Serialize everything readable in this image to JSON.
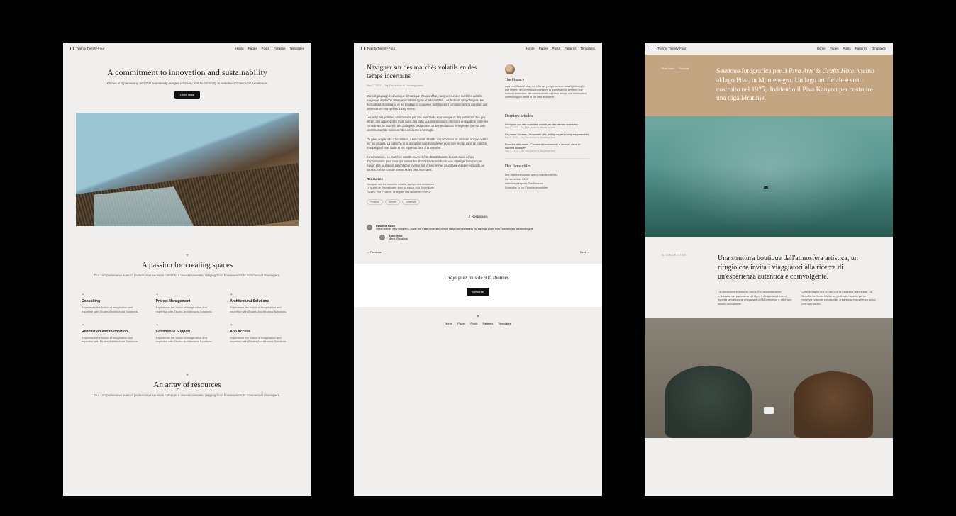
{
  "brand": "Twenty Twenty-Four",
  "nav": [
    "Home",
    "Pages",
    "Posts",
    "Patterns",
    "Templates"
  ],
  "mock1": {
    "hero_title": "A commitment to innovation and sustainability",
    "hero_sub": "Études is a pioneering firm that seamlessly merges creativity and functionality to redefine architectural excellence.",
    "hero_btn": "Learn More",
    "sec2_title": "A passion for creating spaces",
    "sec2_sub": "Our comprehensive suite of professional services caters to a diverse clientele, ranging from homeowners to commercial developers.",
    "cards": [
      {
        "title": "Consulting",
        "body": "Experience the fusion of imagination and expertise with Études Architectural Solutions."
      },
      {
        "title": "Project Management",
        "body": "Experience the fusion of imagination and expertise with Études Architectural Solutions."
      },
      {
        "title": "Architectural Solutions",
        "body": "Experience the fusion of imagination and expertise with Études Architectural Solutions."
      },
      {
        "title": "Renovation and restoration",
        "body": "Experience the fusion of imagination and expertise with Études Architectural Solutions."
      },
      {
        "title": "Continuous Support",
        "body": "Experience the fusion of imagination and expertise with Études Architectural Solutions."
      },
      {
        "title": "App Access",
        "body": "Experience the fusion of imagination and expertise with Études Architectural Solutions."
      }
    ],
    "sec3_title": "An array of resources",
    "sec3_sub": "Our comprehensive suite of professional services caters to a diverse clientele, ranging from homeowners to commercial developers."
  },
  "mock2": {
    "title": "Naviguer sur des marchés volatils en des temps incertains",
    "meta": "Sep 7, 2023 — by The Author in Uncategorized",
    "paras": [
      "Dans le paysage économique dynamique d'aujourd'hui, naviguer sur des marchés volatils exige une approche stratégique alliant agilité et adaptabilité. Les facteurs géopolitiques, les fluctuations monétaires et les tendances nouvelles redéfinissent constamment la direction que prennent les entreprises à long terme.",
      "Les marchés volatiles caractérisés par une incertitude économique et des variations des prix offrent des opportunités mais aussi des défis aux investisseurs. Atteindre un équilibre entre les contraintes de marché, des politiques budgétaires et des tendances émergentes permet aux investisseurs de minimiser des décisions à l'aveugle.",
      "De plus, en période d'incertitude, il est crucial d'établir un processus de décision unique centré sur les risques. La patience et la discipline sont essentielles pour tenir le cap dans ce marché marqué par l'incertitude et les imprévus face à la tempête.",
      "En conclusion, les marchés volatils peuvent être déstabilisants, ils sont aussi riches d'opportunités pour ceux qui savent les aborder avec méthode, une stratégie bien conçue. Savoir être tout aussi patient pour investir sur le long terme, jouir d'une équipe résistante au succès, même lors de moments les plus incertains."
    ],
    "resources_title": "Resources",
    "resources": [
      "Naviguer sur les marchés volatils, aperçu des tendances",
      "Le guide de l'investisseur face au risque et à l'incertitude",
      "Études: The Finance, l'intégrale des nouvelles en PDF"
    ],
    "tags": [
      "Finance",
      "Investir",
      "Stratégie"
    ],
    "author_name": "The Finance",
    "author_bio": "As a new finance blog, we offer our perspective on wealth philosophy that centers around equal importance to both financial freedom and human connection. We communicate via clean design and minimalism, underlining our belief in the best of finance.",
    "recent_title": "Derniers articles",
    "recent": [
      {
        "title": "Naviguer sur des marchés volatils en des temps incertains",
        "meta": "Sep 7, 2023 — by The Author in Uncategorized"
      },
      {
        "title": "Façonner l'avenir : l'essentiel des politiques des banques centrales",
        "meta": "Sep 7, 2023 — by The Author in Uncategorized"
      },
      {
        "title": "Pour les débutants. Comment commencer à investir dans le marché boursier",
        "meta": "Sep 7, 2023 — by The Author in Uncategorized"
      }
    ],
    "links_title": "Des liens utiles",
    "links": [
      "Des marchés volatils, aperçu des tendances",
      "Où investir en 2023",
      "Interview d'experts The Finance",
      "Subscribe to our Finance newsletter"
    ],
    "comments_title": "2 Responses",
    "comments": [
      {
        "name": "Rosalina Finch",
        "body": "Great article! Very insightful. Made me think more about how I approach investing my savings given the uncertainties acknowledged."
      },
      {
        "name": "Anne Grist",
        "body": "Merci, Rosalina!",
        "reply": true
      }
    ],
    "prev": "← Previous",
    "next": "Next →",
    "newsletter_title": "Rejoignez plus de 900 abonnés",
    "newsletter_btn": "S'inscrire"
  },
  "mock3": {
    "crumb": "Piva Hotel — Overlook",
    "lead_pre": "Sessione fotografica per il ",
    "lead_em": "Piva Arts & Crafts Hotel",
    "lead_post": " vicino al lago Piva, in Montenegro. Un lago artificiale è stato costruito nel 1975, dividendo il Piva Kanyon per costruire una diga Mratinje.",
    "sec2_label": "Il collettivo",
    "sec2_title": "Una struttura boutique dall'atmosfera artistica, un rifugio che invita i viaggiatori alla ricerca di un'esperienza autentica e coinvolgente.",
    "col1": "La ubicazione è davvero unica. Ero assolutamente entusiasta del panorama sul lago. Il design degli interni rispetta la tradizione artigianale del Montenegro e offre uno spazio accogliente.",
    "col2": "Ogni dettaglio era curato con la massima attenzione. La filosofia dell'hotel riflette un profondo rispetto per la bellezza naturale circostante, creando un'esperienza unica per ogni ospite."
  }
}
